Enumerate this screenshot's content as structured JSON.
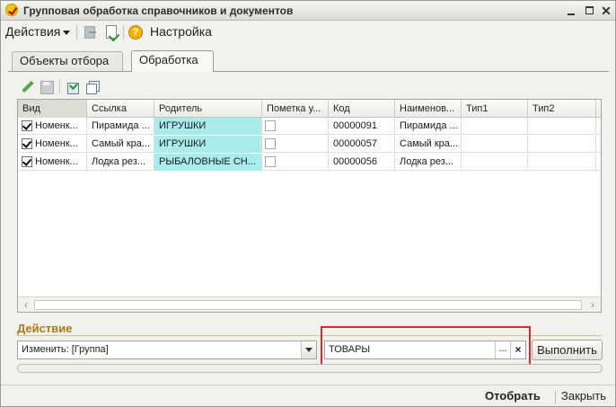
{
  "window": {
    "title": "Групповая обработка справочников и документов"
  },
  "toolbar": {
    "actions_label": "Действия",
    "settings_label": "Настройка",
    "help_glyph": "?"
  },
  "tabs": [
    {
      "label": "Объекты отбора",
      "active": false
    },
    {
      "label": "Обработка",
      "active": true
    }
  ],
  "grid": {
    "columns": [
      "Вид",
      "Ссылка",
      "Родитель",
      "Пометка у...",
      "Код",
      "Наименов...",
      "Тип1",
      "Тип2"
    ],
    "rows": [
      {
        "checked": true,
        "vid": "Номенк...",
        "link": "Пирамида ...",
        "parent": "ИГРУШКИ",
        "mark": false,
        "code": "00000091",
        "name": "Пирамида ...",
        "type1": "",
        "type2": ""
      },
      {
        "checked": true,
        "vid": "Номенк...",
        "link": "Самый кра...",
        "parent": "ИГРУШКИ",
        "mark": false,
        "code": "00000057",
        "name": "Самый кра...",
        "type1": "",
        "type2": ""
      },
      {
        "checked": true,
        "vid": "Номенк...",
        "link": "Лодка рез...",
        "parent": "РЫБАЛОВНЫЕ СН...",
        "mark": false,
        "code": "00000056",
        "name": "Лодка рез...",
        "type1": "",
        "type2": ""
      }
    ],
    "parent_highlight_color": "#a9ecec"
  },
  "action": {
    "section_label": "Действие",
    "select_value": "Изменить: [Группа]",
    "input_value": "ТОВАРЫ",
    "dots_label": "...",
    "clear_label": "×",
    "run_label": "Выполнить",
    "highlight_color": "#d42b33"
  },
  "footer": {
    "select_label": "Отобрать",
    "close_label": "Закрыть"
  },
  "icons": {
    "app": "app-logo-icon",
    "move": "move-icon",
    "doc": "document-check-icon",
    "help": "help-icon",
    "edit": "pencil-icon",
    "save": "save-icon",
    "check_all": "check-all-icon",
    "uncheck_all": "uncheck-all-icon"
  }
}
